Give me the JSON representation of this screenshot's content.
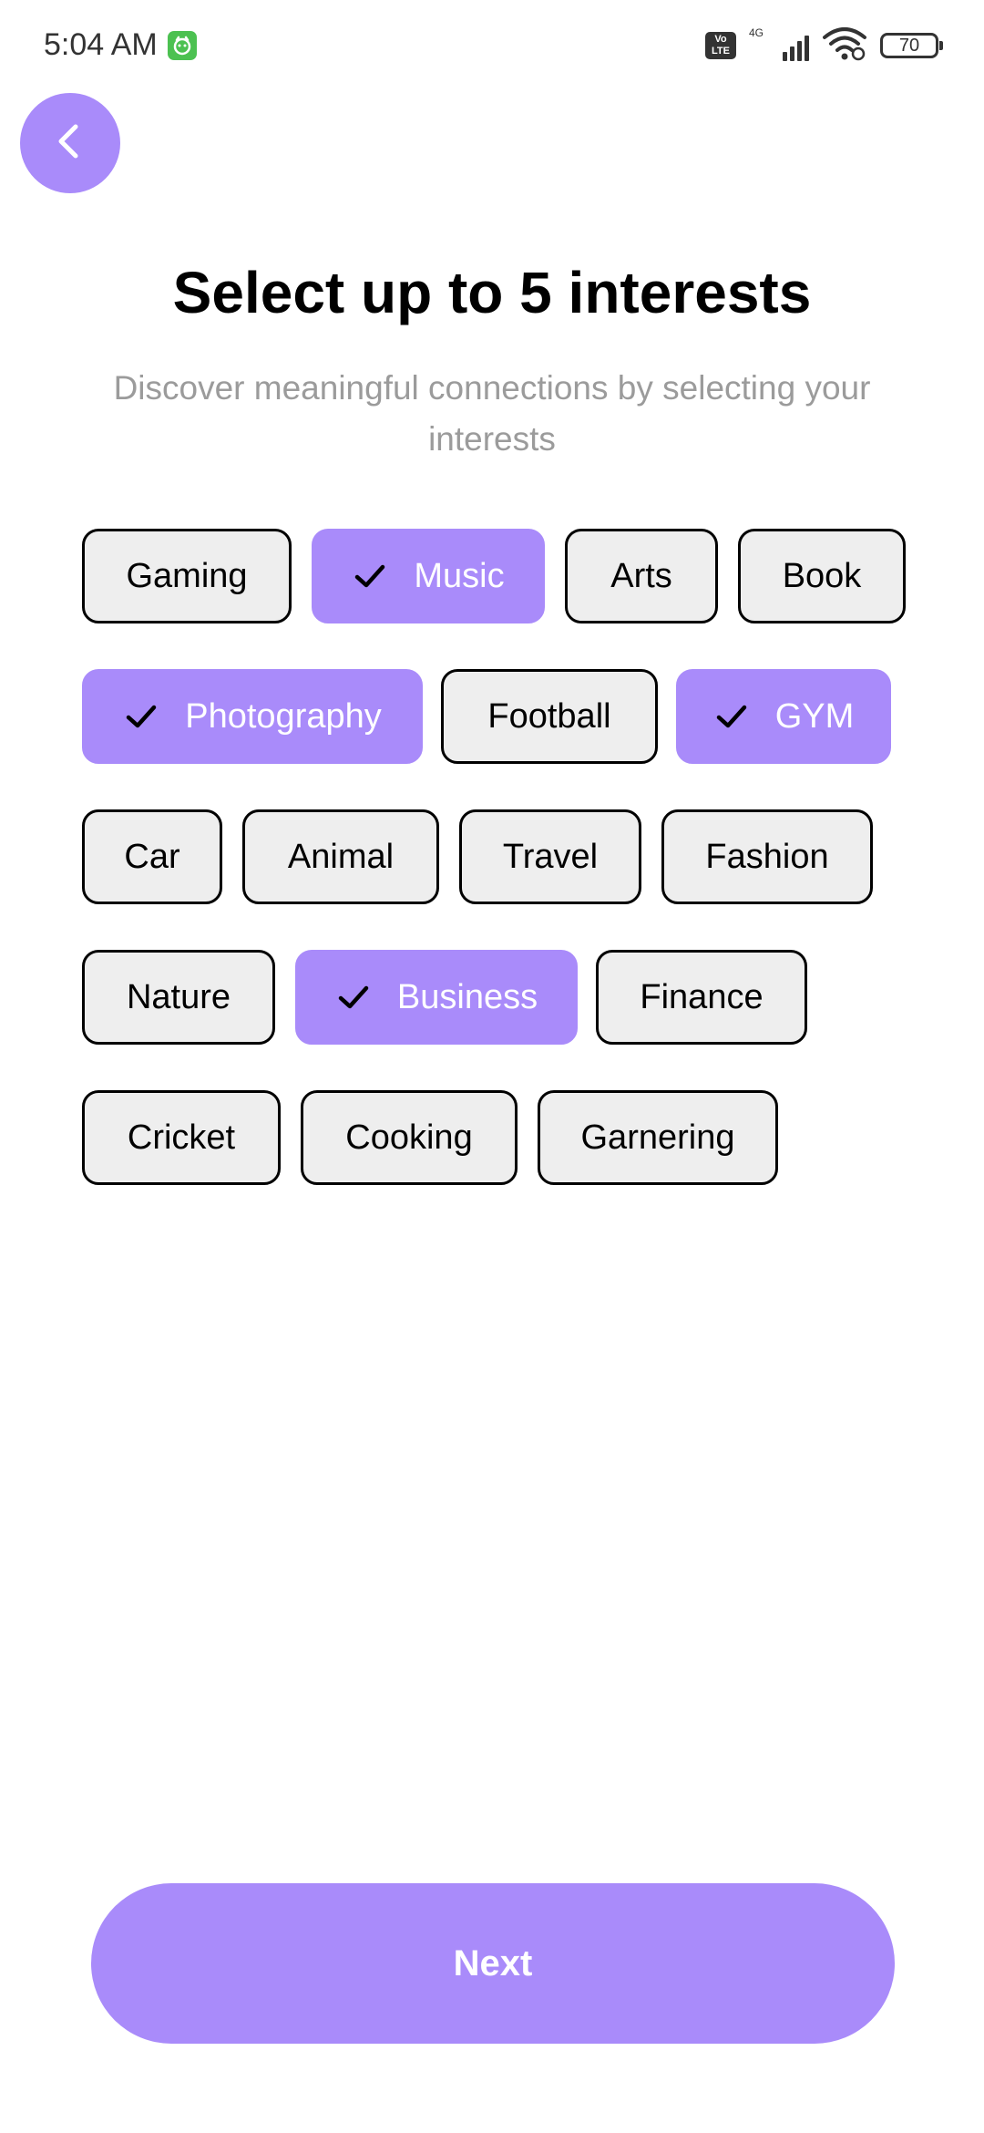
{
  "status_bar": {
    "time": "5:04 AM",
    "network_type": "4G",
    "volte_label_top": "Vo",
    "volte_label_bottom": "LTE",
    "battery_level": "70",
    "icons": [
      "app-notification-icon",
      "volte-icon",
      "signal-icon",
      "wifi-icon",
      "battery-icon"
    ]
  },
  "header": {
    "back_icon": "chevron-left-icon",
    "title": "Select up to 5 interests",
    "subtitle": "Discover meaningful connections by selecting your interests"
  },
  "interests": [
    {
      "label": "Gaming",
      "selected": false
    },
    {
      "label": "Music",
      "selected": true
    },
    {
      "label": "Arts",
      "selected": false
    },
    {
      "label": "Book",
      "selected": false
    },
    {
      "label": "Photography",
      "selected": true
    },
    {
      "label": "Football",
      "selected": false
    },
    {
      "label": "GYM",
      "selected": true
    },
    {
      "label": "Car",
      "selected": false
    },
    {
      "label": "Animal",
      "selected": false
    },
    {
      "label": "Travel",
      "selected": false
    },
    {
      "label": "Fashion",
      "selected": false
    },
    {
      "label": "Nature",
      "selected": false
    },
    {
      "label": "Business",
      "selected": true
    },
    {
      "label": "Finance",
      "selected": false
    },
    {
      "label": "Cricket",
      "selected": false
    },
    {
      "label": "Cooking",
      "selected": false
    },
    {
      "label": "Garnering",
      "selected": false
    }
  ],
  "footer": {
    "next_label": "Next"
  },
  "colors": {
    "accent": "#a98bfa",
    "chip_background": "#eeeeee",
    "subtitle_text": "#9b9b9b",
    "text": "#000000"
  }
}
